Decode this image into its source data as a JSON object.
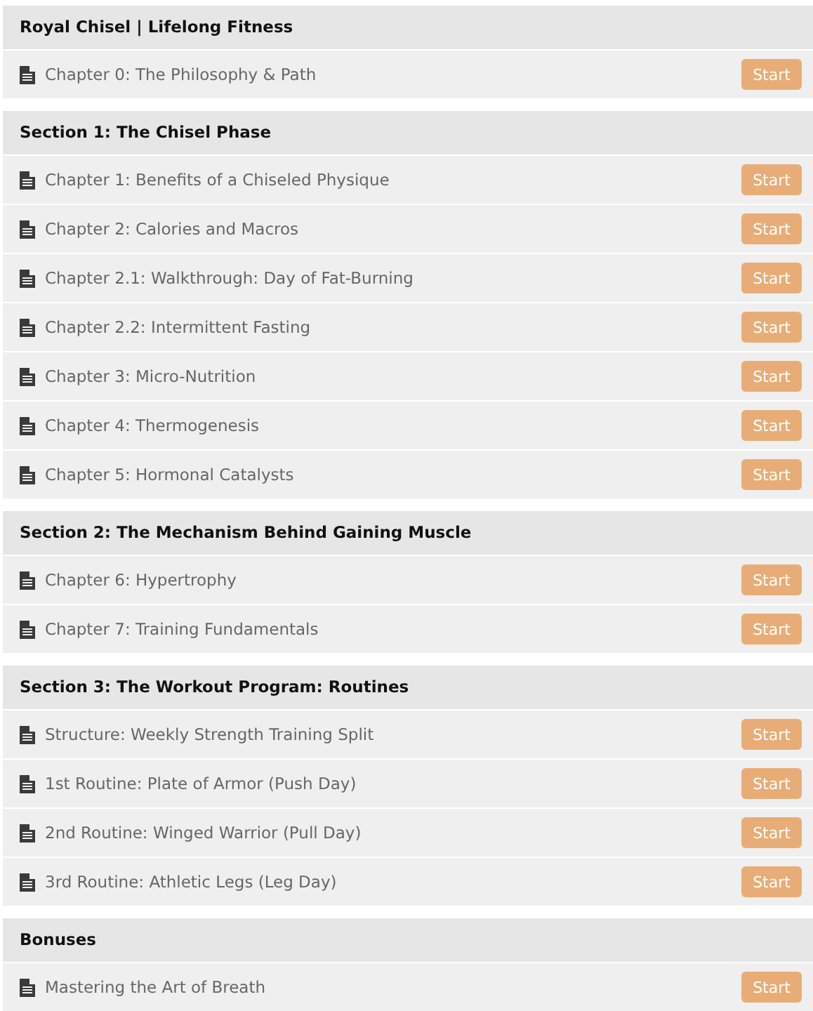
{
  "sections": [
    {
      "title": "Royal Chisel | Lifelong Fitness",
      "lessons": [
        {
          "title": "Chapter 0: The Philosophy & Path",
          "button": "Start"
        }
      ]
    },
    {
      "title": "Section 1: The Chisel Phase",
      "lessons": [
        {
          "title": "Chapter 1: Benefits of a Chiseled Physique",
          "button": "Start"
        },
        {
          "title": "Chapter 2: Calories and Macros",
          "button": "Start"
        },
        {
          "title": "Chapter 2.1: Walkthrough: Day of Fat-Burning",
          "button": "Start"
        },
        {
          "title": "Chapter 2.2: Intermittent Fasting",
          "button": "Start"
        },
        {
          "title": "Chapter 3: Micro-Nutrition",
          "button": "Start"
        },
        {
          "title": "Chapter 4: Thermogenesis",
          "button": "Start"
        },
        {
          "title": "Chapter 5: Hormonal Catalysts",
          "button": "Start"
        }
      ]
    },
    {
      "title": "Section 2: The Mechanism Behind Gaining Muscle",
      "lessons": [
        {
          "title": "Chapter 6: Hypertrophy",
          "button": "Start"
        },
        {
          "title": "Chapter 7: Training Fundamentals",
          "button": "Start"
        }
      ]
    },
    {
      "title": "Section 3: The Workout Program: Routines",
      "lessons": [
        {
          "title": "Structure: Weekly Strength Training Split",
          "button": "Start"
        },
        {
          "title": "1st Routine: Plate of Armor (Push Day)",
          "button": "Start"
        },
        {
          "title": "2nd Routine: Winged Warrior (Pull Day)",
          "button": "Start"
        },
        {
          "title": "3rd Routine: Athletic Legs (Leg Day)",
          "button": "Start"
        }
      ]
    },
    {
      "title": "Bonuses",
      "lessons": [
        {
          "title": "Mastering the Art of Breath",
          "button": "Start"
        }
      ]
    }
  ]
}
